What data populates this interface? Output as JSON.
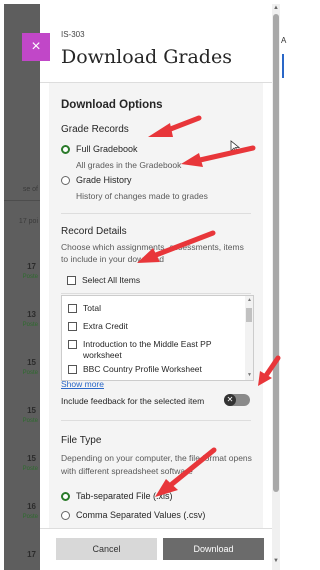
{
  "course_code": "IS-303",
  "panel_title": "Download Grades",
  "close_icon": "×",
  "download_options": {
    "heading": "Download Options",
    "grade_records": {
      "heading": "Grade Records",
      "options": [
        {
          "label": "Full Gradebook",
          "desc": "All grades in the Gradebook",
          "selected": true
        },
        {
          "label": "Grade History",
          "desc": "History of changes made to grades",
          "selected": false
        }
      ]
    }
  },
  "record_details": {
    "heading": "Record Details",
    "desc_line1": "Choose which assignments, assessments, items",
    "desc_line2": "to include in your download",
    "select_all": "Select All Items",
    "items": [
      "Total",
      "Extra Credit",
      "Introduction to the Middle East PP",
      "worksheet",
      "BBC Country Profile Worksheet"
    ],
    "show_more": "Show more",
    "feedback_label": "Include feedback for the selected item"
  },
  "file_type": {
    "heading": "File Type",
    "desc_line1": "Depending on your computer, the file format opens",
    "desc_line2": "with different spreadsheet software",
    "options": [
      {
        "label": "Tab-separated File (.xls)",
        "selected": true
      },
      {
        "label": "Comma Separated Values (.csv)",
        "selected": false
      }
    ]
  },
  "buttons": {
    "cancel": "Cancel",
    "download": "Download"
  },
  "background": {
    "left_labels": [
      "se of",
      "17 poi",
      "17",
      "Poste",
      "13",
      "Poste",
      "15",
      "Poste",
      "15",
      "Poste",
      "15",
      "Poste",
      "16",
      "Poste",
      "17"
    ],
    "right_letter": "A"
  },
  "colors": {
    "accent": "#c147c8",
    "selected_radio": "#2a7a2a",
    "arrow": "#e8363a",
    "link": "#2a67c7"
  }
}
